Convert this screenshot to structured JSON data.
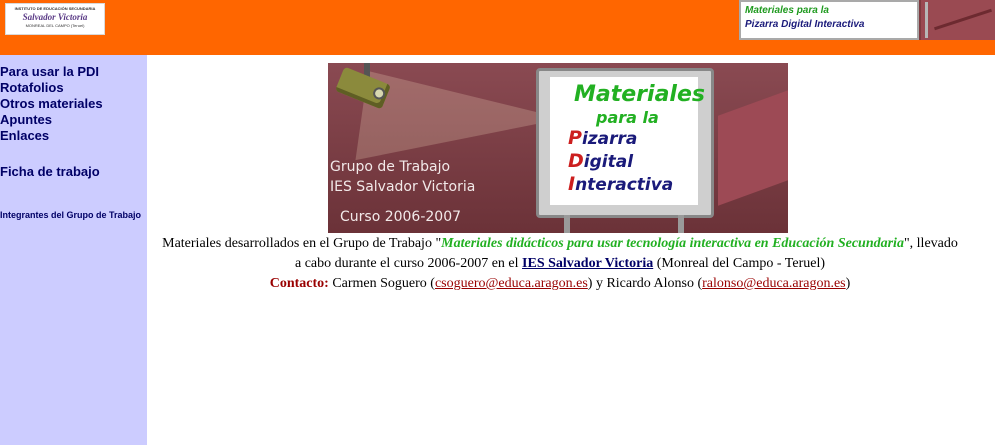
{
  "header": {
    "logo": {
      "line1": "INSTITUTO DE EDUCACIÓN SECUNDARIA",
      "line2": "Salvador Victoria",
      "line3": "MONREAL DEL CAMPO (Teruel)"
    },
    "banner": {
      "line1": "Materiales para la",
      "line2": "Pizarra Digital Interactiva"
    },
    "colors": {
      "bar": "#ff6600",
      "sidebar": "#ccccff"
    }
  },
  "sidebar": {
    "items": [
      {
        "label": "Para usar la PDI"
      },
      {
        "label": "Rotafolios"
      },
      {
        "label": "Otros materiales"
      },
      {
        "label": "Apuntes"
      },
      {
        "label": "Enlaces"
      }
    ],
    "worksheet": "Ficha de trabajo",
    "members": "Integrantes del Grupo de Trabajo"
  },
  "hero": {
    "screen_line1": "Materiales",
    "screen_line2": "para la",
    "screen_words": [
      {
        "first": "P",
        "rest": "izarra"
      },
      {
        "first": "D",
        "rest": "igital"
      },
      {
        "first": "I",
        "rest": "nteractiva"
      }
    ],
    "caption1": "Grupo de Trabajo",
    "caption2": "IES Salvador Victoria",
    "caption3": "Curso 2006-2007"
  },
  "description": {
    "intro": "Materiales desarrollados en el Grupo de Trabajo \"",
    "project": "Materiales didácticos para usar tecnología interactiva en Educación Secundaria",
    "middle": "\", llevado a cabo durante el curso 2006-2007 en el ",
    "school": "IES Salvador Victoria",
    "location": " (Monreal del Campo - Teruel)",
    "contact_label": "Contacto:",
    "contact1_name": " Carmen Soguero (",
    "contact1_email": "csoguero@educa.aragon.es",
    "contact1_close": ")  y  Ricardo Alonso (",
    "contact2_email": "ralonso@educa.aragon.es",
    "contact2_close": ")"
  }
}
